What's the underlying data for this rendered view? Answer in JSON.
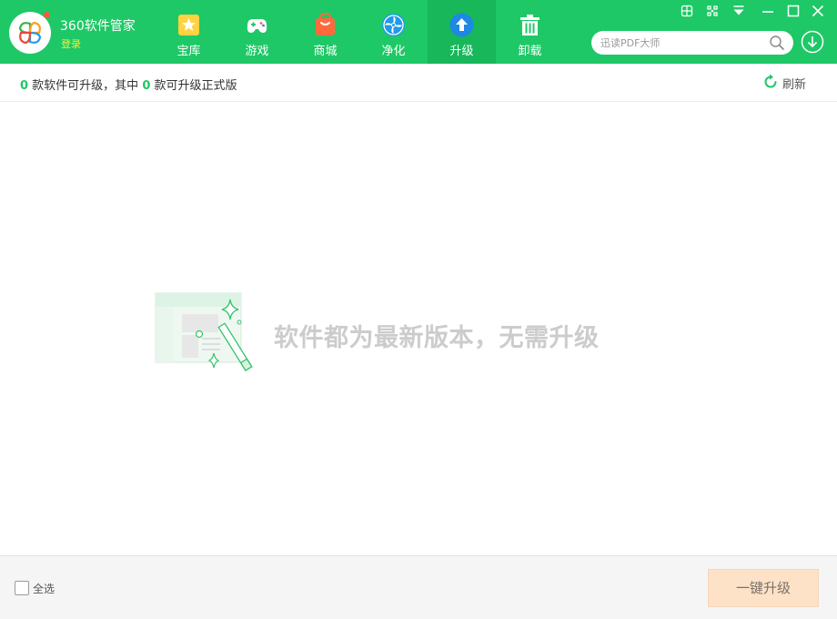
{
  "app": {
    "name": "360软件管家",
    "login_label": "登录",
    "accent_color": "#1ec866"
  },
  "nav": {
    "tabs": [
      {
        "label": "宝库",
        "icon": "star-icon"
      },
      {
        "label": "游戏",
        "icon": "gamepad-icon"
      },
      {
        "label": "商城",
        "icon": "shopping-bag-icon"
      },
      {
        "label": "净化",
        "icon": "purify-fan-icon"
      },
      {
        "label": "升级",
        "icon": "upgrade-arrow-icon",
        "active": true
      },
      {
        "label": "卸载",
        "icon": "trash-icon"
      }
    ]
  },
  "window_controls": [
    "globe-icon",
    "skin-icon",
    "menu-dropdown-icon",
    "minimize-icon",
    "maximize-icon",
    "close-icon"
  ],
  "search": {
    "placeholder": "迅读PDF大师",
    "value": ""
  },
  "info_bar": {
    "upgradable_count": "0",
    "text_1": " 款软件可升级，其中 ",
    "official_count": "0",
    "text_2": " 款可升级正式版",
    "refresh_label": "刷新"
  },
  "empty_state": {
    "message": "软件都为最新版本，无需升级"
  },
  "footer": {
    "select_all_label": "全选",
    "select_all_checked": false,
    "upgrade_all_label": "一键升级"
  }
}
